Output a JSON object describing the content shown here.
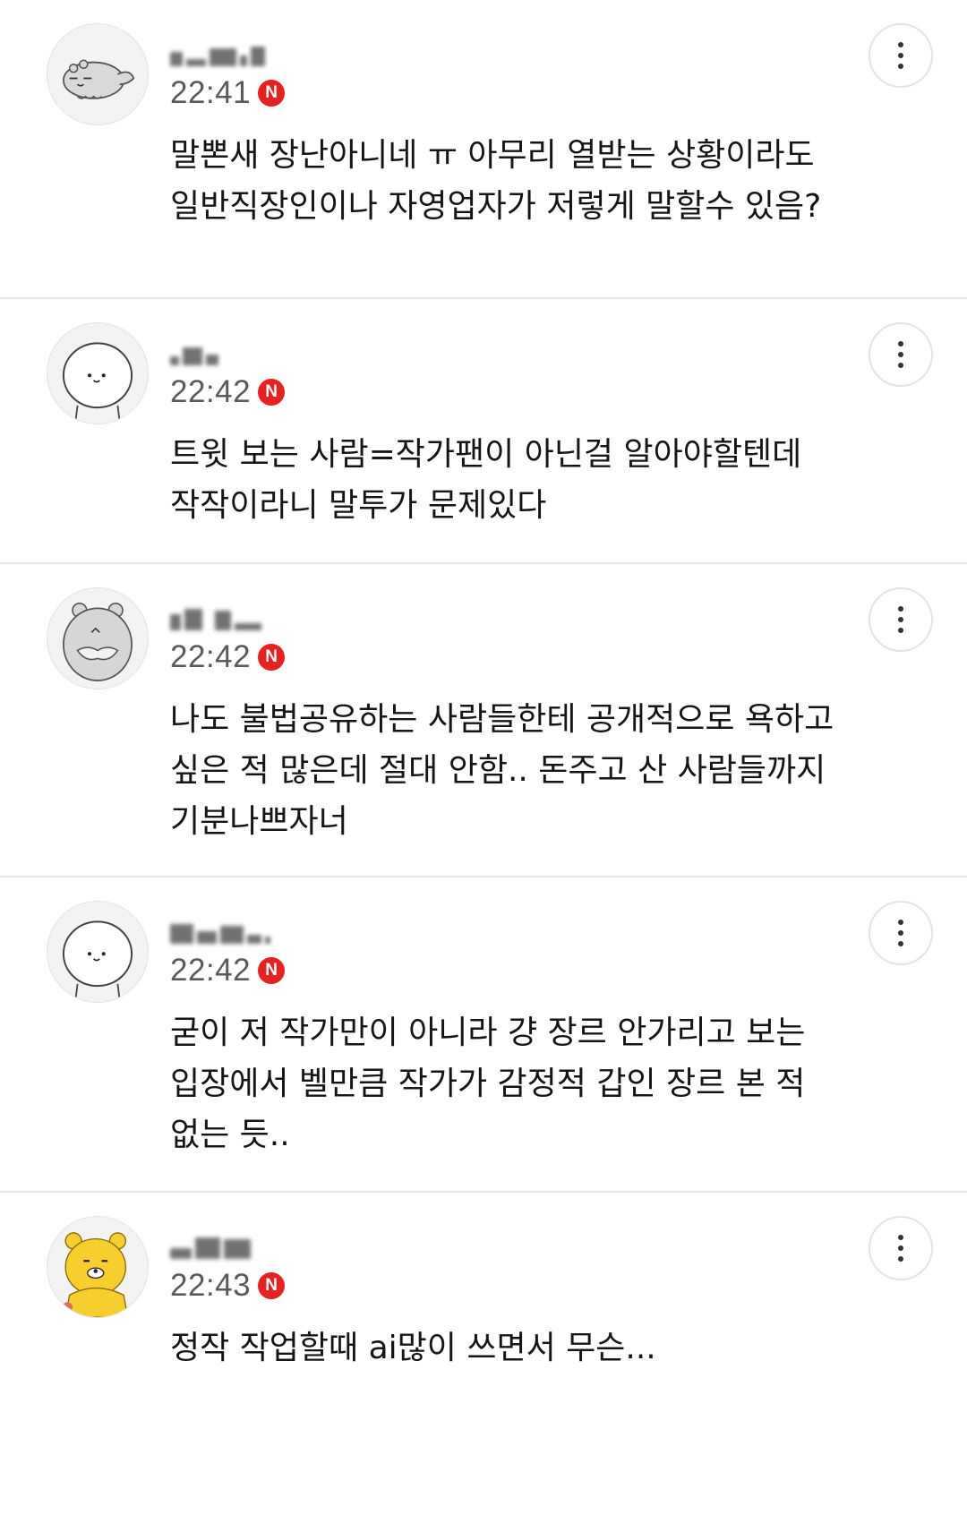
{
  "comments": [
    {
      "time": "22:41",
      "badge": "N",
      "text": "말뽄새 장난아니네 ㅠ 아무리 열받는 상황이라도 일반직장인이나 자영업자가 저렇게 말할수 있음?",
      "avatar_icon": "sleeping-animal-avatar-icon"
    },
    {
      "time": "22:42",
      "badge": "N",
      "text": "트윗 보는 사람=작가팬이 아닌걸 알아야할텐데 작작이라니 말투가 문제있다",
      "avatar_icon": "white-blob-avatar-icon"
    },
    {
      "time": "22:42",
      "badge": "N",
      "text": "나도 불법공유하는 사람들한테 공개적으로 욕하고 싶은 적 많은데 절대 안함.. 돈주고 산 사람들까지 기분나쁘자너",
      "avatar_icon": "hamster-avatar-icon"
    },
    {
      "time": "22:42",
      "badge": "N",
      "text": "굳이 저 작가만이 아니라 걍 장르 안가리고 보는 입장에서 벨만큼 작가가 감정적 갑인 장르 본 적 없는 듯..",
      "avatar_icon": "white-blob-avatar-icon"
    },
    {
      "time": "22:43",
      "badge": "N",
      "text": "정작 작업할때 ai많이 쓰면서 무슨...",
      "avatar_icon": "yellow-bear-avatar-icon"
    }
  ],
  "colors": {
    "badge": "#e8201f",
    "time": "#5a5a5a",
    "divider": "#e6e6e6",
    "bear": "#f6cf2f"
  }
}
